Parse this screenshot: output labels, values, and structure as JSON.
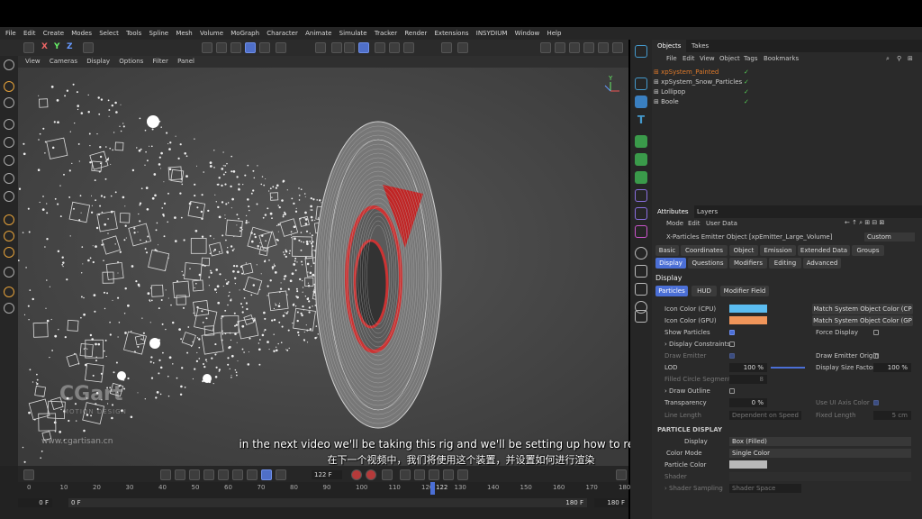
{
  "menu": [
    "File",
    "Edit",
    "Create",
    "Modes",
    "Select",
    "Tools",
    "Spline",
    "Mesh",
    "Volume",
    "MoGraph",
    "Character",
    "Animate",
    "Simulate",
    "Tracker",
    "Render",
    "Extensions",
    "INSYDIUM",
    "Window",
    "Help"
  ],
  "toolbar": {
    "axes": [
      "X",
      "Y",
      "Z"
    ]
  },
  "viewport_menu": [
    "View",
    "Cameras",
    "Display",
    "Options",
    "Filter",
    "Panel"
  ],
  "watermark": {
    "brand": "CGart",
    "sub": "MOTION DESIGN",
    "url": "www.cgartisan.cn"
  },
  "subtitle": {
    "en": "in the next video we'll be taking this rig and we'll be setting up how to render it in",
    "zh": "在下一个视频中，我们将使用这个装置，并设置如何进行渲染"
  },
  "timeline": {
    "current_frame": "122 F",
    "ticks": [
      "0",
      "10",
      "20",
      "30",
      "40",
      "50",
      "60",
      "70",
      "80",
      "90",
      "100",
      "110",
      "120",
      "130",
      "140",
      "150",
      "160",
      "170",
      "180"
    ],
    "playhead_label": "122",
    "start": "0 F",
    "start2": "0 F",
    "end": "180 F",
    "end2": "180 F"
  },
  "objects_panel": {
    "tabs": [
      "Objects",
      "Takes"
    ],
    "menu": [
      "File",
      "Edit",
      "View",
      "Object",
      "Tags",
      "Bookmarks"
    ],
    "items": [
      {
        "name": "xpSystem_Painted",
        "color": "#e07a2a"
      },
      {
        "name": "xpSystem_Snow_Particles",
        "color": "#cfcfcf"
      },
      {
        "name": "Lollipop",
        "color": "#cfcfcf"
      },
      {
        "name": "Boole",
        "color": "#cfcfcf"
      }
    ]
  },
  "attributes": {
    "tabs": [
      "Attributes",
      "Layers"
    ],
    "menu": [
      "Mode",
      "Edit",
      "User Data"
    ],
    "object_title": "X-Particles Emitter Object [xpEmitter_Large_Volume]",
    "preset": "Custom",
    "tabs_row1": [
      "Basic",
      "Coordinates",
      "Object",
      "Emission",
      "Extended Data",
      "Groups"
    ],
    "tabs_row2": [
      "Display",
      "Questions",
      "Modifiers",
      "Editing",
      "Advanced"
    ],
    "section": "Display",
    "subtabs": [
      "Particles",
      "HUD",
      "Modifier Field"
    ],
    "icon_color_cpu": "Icon Color (CPU)",
    "icon_color_gpu": "Icon Color (GPU)",
    "cpu_color": "#5bbcf0",
    "gpu_color": "#f0955a",
    "match_cpu": "Match System Object Color (CP",
    "match_gpu": "Match System Object Color (GP",
    "show_particles": "Show Particles",
    "force_display": "Force Display",
    "display_constraints": "› Display Constraints",
    "draw_emitter": "Draw Emitter",
    "draw_emitter_origin": "Draw Emitter Origin",
    "lod": "LOD",
    "lod_value": "100 %",
    "display_size_factor": "Display Size Factor",
    "dsf_value": "100 %",
    "filled_circle_segments": "Filled Circle Segments",
    "fcs_value": "8",
    "draw_outline": "› Draw Outline",
    "transparency": "Transparency",
    "transparency_value": "0 %",
    "use_ui_axis_color": "Use UI Axis Color",
    "line_length": "Line Length",
    "line_length_mode": "Dependent on Speed",
    "fixed_length": "Fixed Length",
    "fixed_length_value": "5 cm",
    "particle_display_header": "PARTICLE DISPLAY",
    "display": "Display",
    "display_value": "Box (Filled)",
    "color_mode": "Color Mode",
    "color_mode_value": "Single Color",
    "particle_color": "Particle Color",
    "shader": "Shader",
    "shader_sampling": "› Shader Sampling",
    "shader_sampling_value": "Shader Space"
  }
}
